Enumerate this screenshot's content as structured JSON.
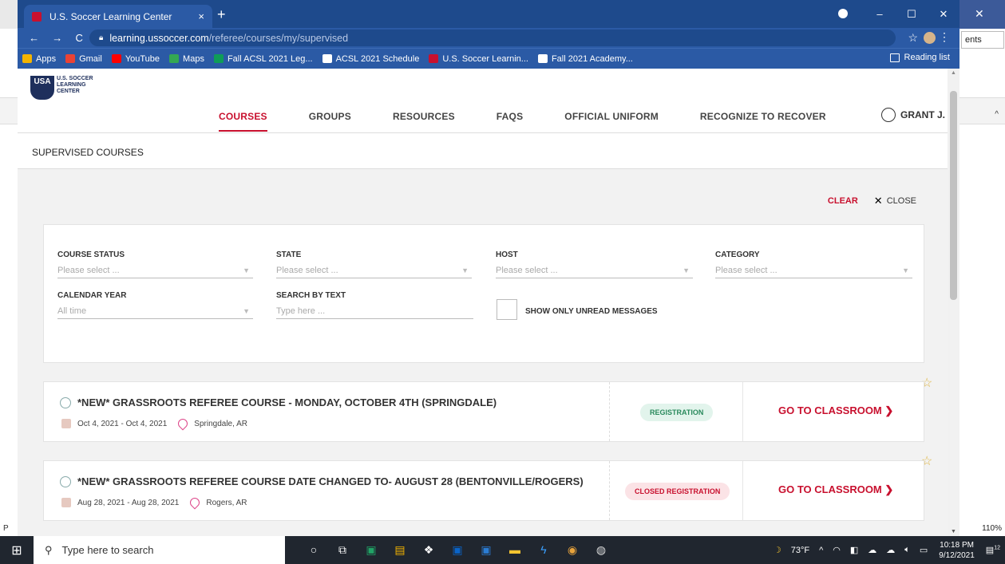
{
  "browser": {
    "tab_title": "U.S. Soccer Learning Center",
    "tab_close": "×",
    "new_tab": "+",
    "url_domain": "learning.ussoccer.com",
    "url_path": "/referee/courses/my/supervised",
    "win_min": "–",
    "win_max": "☐",
    "win_close": "✕",
    "bookmarks": [
      {
        "label": "Apps",
        "color": "#f4b400"
      },
      {
        "label": "Gmail",
        "color": "#ea4335"
      },
      {
        "label": "YouTube",
        "color": "#ff0000"
      },
      {
        "label": "Maps",
        "color": "#34a853"
      },
      {
        "label": "Fall ACSL 2021 Leg...",
        "color": "#0f9d58"
      },
      {
        "label": "ACSL 2021 Schedule",
        "color": "#ffffff"
      },
      {
        "label": "U.S. Soccer Learnin...",
        "color": "#c8102e"
      },
      {
        "label": "Fall 2021 Academy...",
        "color": "#ffffff"
      }
    ],
    "reading_list": "Reading list"
  },
  "background_app": {
    "button": "ents",
    "zoom": "110%",
    "left_letter": "P"
  },
  "site": {
    "logo_mark": "USA",
    "logo_text": "U.S. SOCCER LEARNING CENTER",
    "nav": [
      "COURSES",
      "GROUPS",
      "RESOURCES",
      "FAQS",
      "OFFICIAL UNIFORM",
      "RECOGNIZE TO RECOVER"
    ],
    "user": "GRANT J.",
    "subtitle": "SUPERVISED COURSES",
    "clear": "CLEAR",
    "close": "CLOSE"
  },
  "filters": {
    "course_status": {
      "label": "COURSE STATUS",
      "placeholder": "Please select ..."
    },
    "state": {
      "label": "STATE",
      "placeholder": "Please select ..."
    },
    "host": {
      "label": "HOST",
      "placeholder": "Please select ..."
    },
    "category": {
      "label": "CATEGORY",
      "placeholder": "Please select ..."
    },
    "calendar_year": {
      "label": "CALENDAR YEAR",
      "value": "All time"
    },
    "search_by_text": {
      "label": "SEARCH BY TEXT",
      "placeholder": "Type here ..."
    },
    "unread_label": "SHOW ONLY UNREAD MESSAGES"
  },
  "courses": [
    {
      "title": "*NEW* GRASSROOTS REFEREE COURSE - MONDAY, OCTOBER 4TH (SPRINGDALE)",
      "dates": "Oct 4, 2021 - Oct 4, 2021",
      "location": "Springdale, AR",
      "status": "REGISTRATION",
      "action": "GO TO CLASSROOM ❯"
    },
    {
      "title": "*NEW* GRASSROOTS REFEREE COURSE DATE CHANGED TO- AUGUST 28 (BENTONVILLE/ROGERS)",
      "dates": "Aug 28, 2021 - Aug 28, 2021",
      "location": "Rogers, AR",
      "status": "CLOSED REGISTRATION",
      "action": "GO TO CLASSROOM ❯"
    }
  ],
  "taskbar": {
    "search_placeholder": "Type here to search",
    "weather": "73°F",
    "time": "10:18 PM",
    "date": "9/12/2021",
    "notifications": "12"
  }
}
